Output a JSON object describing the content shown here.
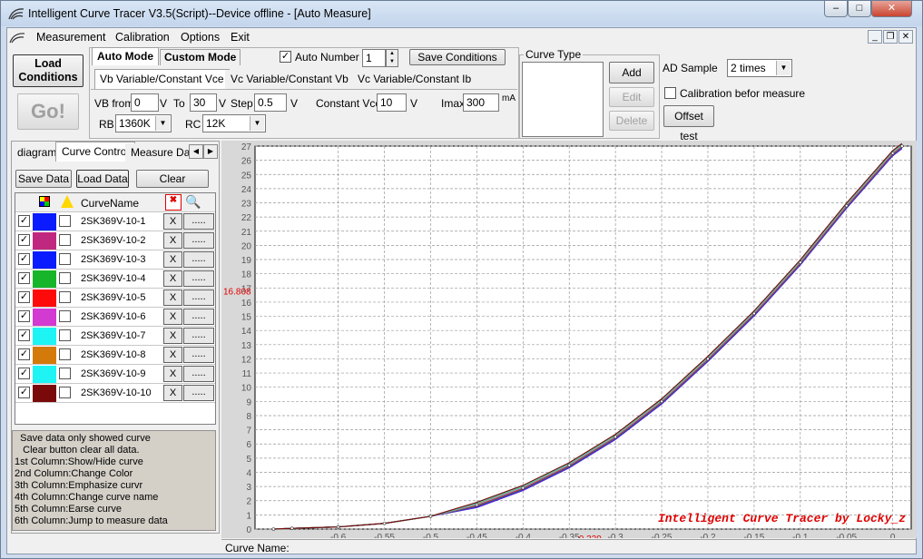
{
  "window": {
    "title": "Intelligent Curve Tracer V3.5(Script)--Device offline - [Auto Measure]",
    "minimize": "–",
    "maximize": "□",
    "close": "✕"
  },
  "menu": {
    "items": [
      "Measurement",
      "Calibration",
      "Options",
      "Exit"
    ]
  },
  "mdi": {
    "minimize": "_",
    "restore": "❐",
    "close": "✕"
  },
  "left_buttons": {
    "load_conditions": "Load Conditions",
    "go": "Go!"
  },
  "mode_tabs": {
    "auto": "Auto Mode",
    "custom": "Custom Mode"
  },
  "auto_number": {
    "label": "Auto Number",
    "checked": true,
    "value": "1"
  },
  "save_conditions": "Save Conditions",
  "sub_tabs": [
    "Vb Variable/Constant Vce",
    "Vc Variable/Constant Vb",
    "Vc Variable/Constant Ib"
  ],
  "params": {
    "vb_from_label": "VB from",
    "vb_from": "0",
    "v1": "V",
    "to_label": "To",
    "to": "30",
    "v2": "V",
    "step_label": "Step",
    "step": "0.5",
    "v3": "V",
    "const_vce_label": "Constant Vce",
    "const_vce": "10",
    "v4": "V",
    "imax_label": "Imax",
    "imax": "300",
    "ma": "mA",
    "rb_label": "RB",
    "rb": "1360K",
    "rc_label": "RC",
    "rc": "12K"
  },
  "curve_type": {
    "title": "Curve Type",
    "add": "Add",
    "edit": "Edit",
    "delete": "Delete"
  },
  "ad_sample": {
    "label": "AD Sample",
    "value": "2 times"
  },
  "calibration": {
    "label": "Calibration befor measure",
    "checked": false
  },
  "offset_test": "Offset test",
  "panel_tabs": [
    "diagram",
    "Curve Control",
    "Measure Data"
  ],
  "panel_buttons": {
    "save": "Save Data",
    "load": "Load Data",
    "clear": "Clear"
  },
  "table": {
    "header": "CurveName",
    "rows": [
      {
        "name": "2SK369V-10-1",
        "color": "#0a1cff"
      },
      {
        "name": "2SK369V-10-2",
        "color": "#c0287f"
      },
      {
        "name": "2SK369V-10-3",
        "color": "#0a1cff"
      },
      {
        "name": "2SK369V-10-4",
        "color": "#17b52a"
      },
      {
        "name": "2SK369V-10-5",
        "color": "#ff0a0a"
      },
      {
        "name": "2SK369V-10-6",
        "color": "#d23ad2"
      },
      {
        "name": "2SK369V-10-7",
        "color": "#1ef4f4"
      },
      {
        "name": "2SK369V-10-8",
        "color": "#d47a0a"
      },
      {
        "name": "2SK369V-10-9",
        "color": "#1ef4f4"
      },
      {
        "name": "2SK369V-10-10",
        "color": "#7a0a0a"
      }
    ],
    "x_label": "X",
    "dots_label": "....."
  },
  "help_lines": [
    "  Save data only showed curve",
    "   Clear button clear all data.",
    "1st Column:Show/Hide curve",
    "2nd Column:Change Color",
    "3th Column:Emphasize curvr",
    "4th Column:Change curve name",
    "5th Column:Earse curve",
    "6th Column:Jump to measure data"
  ],
  "status": {
    "curve_name": "Curve Name:"
  },
  "chart_data": {
    "type": "line",
    "xlim": [
      -0.69,
      0.02
    ],
    "ylim": [
      0,
      27
    ],
    "x_ticks": [
      -0.6,
      -0.55,
      -0.5,
      -0.45,
      -0.4,
      -0.35,
      -0.3,
      -0.25,
      -0.2,
      -0.15,
      -0.1,
      -0.05,
      0
    ],
    "y_ticks": [
      0,
      1,
      2,
      3,
      4,
      5,
      6,
      7,
      8,
      9,
      10,
      11,
      12,
      13,
      14,
      15,
      16,
      17,
      18,
      19,
      20,
      21,
      22,
      23,
      24,
      25,
      26,
      27
    ],
    "cursor": {
      "x": -0.329,
      "y": 16.808,
      "x_label": "-0.329",
      "y_label": "16.808"
    },
    "watermark": "Intelligent Curve Tracer by Locky_z",
    "grid": true,
    "x": [
      -0.67,
      -0.65,
      -0.6,
      -0.55,
      -0.5,
      -0.45,
      -0.4,
      -0.35,
      -0.3,
      -0.25,
      -0.2,
      -0.15,
      -0.1,
      -0.05,
      0,
      0.01
    ],
    "series_colors": [
      "#0a1cff",
      "#c0287f",
      "#0a1cff",
      "#17b52a",
      "#ff0a0a",
      "#d23ad2",
      "#1ef4f4",
      "#d47a0a",
      "#1ef4f4",
      "#7a0a0a"
    ],
    "values": [
      0,
      0.05,
      0.15,
      0.4,
      0.9,
      1.7,
      2.9,
      4.5,
      6.5,
      9.0,
      12.0,
      15.2,
      18.8,
      22.8,
      26.5,
      27
    ]
  }
}
